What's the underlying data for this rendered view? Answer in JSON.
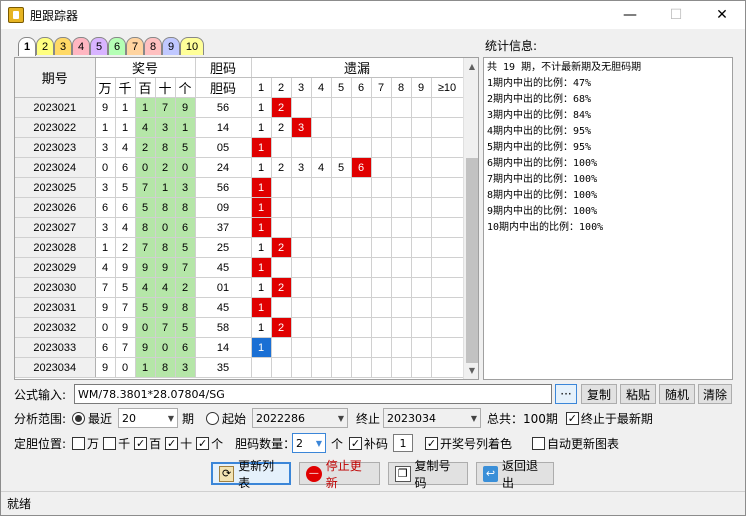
{
  "window": {
    "title": "胆跟踪器",
    "min": "—",
    "max": "☐",
    "close": "✕"
  },
  "tabs": [
    "1",
    "2",
    "3",
    "4",
    "5",
    "6",
    "7",
    "8",
    "9",
    "10"
  ],
  "tab_colors": [
    "#e8e8e8",
    "#ffff80",
    "#ffd966",
    "#ffb6c1",
    "#d8b4ff",
    "#b4ffb4",
    "#ffd4a0",
    "#ffc0c0",
    "#c0c8ff",
    "#ffff99"
  ],
  "grid": {
    "h_period": "期号",
    "h_lottery": "奖号",
    "h_danma": "胆码",
    "h_miss": "遗漏",
    "sub_lottery": [
      "万",
      "千",
      "百",
      "十",
      "个"
    ],
    "sub_danma": "胆码",
    "sub_miss": [
      "1",
      "2",
      "3",
      "4",
      "5",
      "6",
      "7",
      "8",
      "9",
      "≥10"
    ],
    "rows": [
      {
        "period": "2023021",
        "nums": [
          "9",
          "1",
          "1",
          "7",
          "9"
        ],
        "danma": "56",
        "miss": [
          "1",
          "2",
          "",
          "",
          "",
          "",
          "",
          "",
          "",
          ""
        ],
        "marks": [
          "",
          "red",
          "",
          "",
          "",
          "",
          "",
          "",
          "",
          ""
        ]
      },
      {
        "period": "2023022",
        "nums": [
          "1",
          "1",
          "4",
          "3",
          "1"
        ],
        "danma": "14",
        "miss": [
          "1",
          "2",
          "3",
          "",
          "",
          "",
          "",
          "",
          "",
          ""
        ],
        "marks": [
          "",
          "",
          "red",
          "",
          "",
          "",
          "",
          "",
          "",
          ""
        ]
      },
      {
        "period": "2023023",
        "nums": [
          "3",
          "4",
          "2",
          "8",
          "5"
        ],
        "danma": "05",
        "miss": [
          "1",
          "",
          "",
          "",
          "",
          "",
          "",
          "",
          "",
          ""
        ],
        "marks": [
          "red",
          "",
          "",
          "",
          "",
          "",
          "",
          "",
          "",
          ""
        ]
      },
      {
        "period": "2023024",
        "nums": [
          "0",
          "6",
          "0",
          "2",
          "0"
        ],
        "danma": "24",
        "miss": [
          "1",
          "2",
          "3",
          "4",
          "5",
          "6",
          "",
          "",
          "",
          ""
        ],
        "marks": [
          "",
          "",
          "",
          "",
          "",
          "red",
          "",
          "",
          "",
          ""
        ]
      },
      {
        "period": "2023025",
        "nums": [
          "3",
          "5",
          "7",
          "1",
          "3"
        ],
        "danma": "56",
        "miss": [
          "1",
          "",
          "",
          "",
          "",
          "",
          "",
          "",
          "",
          ""
        ],
        "marks": [
          "red",
          "",
          "",
          "",
          "",
          "",
          "",
          "",
          "",
          ""
        ]
      },
      {
        "period": "2023026",
        "nums": [
          "6",
          "6",
          "5",
          "8",
          "8"
        ],
        "danma": "09",
        "miss": [
          "1",
          "",
          "",
          "",
          "",
          "",
          "",
          "",
          "",
          ""
        ],
        "marks": [
          "red",
          "",
          "",
          "",
          "",
          "",
          "",
          "",
          "",
          ""
        ]
      },
      {
        "period": "2023027",
        "nums": [
          "3",
          "4",
          "8",
          "0",
          "6"
        ],
        "danma": "37",
        "miss": [
          "1",
          "",
          "",
          "",
          "",
          "",
          "",
          "",
          "",
          ""
        ],
        "marks": [
          "red",
          "",
          "",
          "",
          "",
          "",
          "",
          "",
          "",
          ""
        ]
      },
      {
        "period": "2023028",
        "nums": [
          "1",
          "2",
          "7",
          "8",
          "5"
        ],
        "danma": "25",
        "miss": [
          "1",
          "2",
          "",
          "",
          "",
          "",
          "",
          "",
          "",
          ""
        ],
        "marks": [
          "",
          "red",
          "",
          "",
          "",
          "",
          "",
          "",
          "",
          ""
        ]
      },
      {
        "period": "2023029",
        "nums": [
          "4",
          "9",
          "9",
          "9",
          "7"
        ],
        "danma": "45",
        "miss": [
          "1",
          "",
          "",
          "",
          "",
          "",
          "",
          "",
          "",
          ""
        ],
        "marks": [
          "red",
          "",
          "",
          "",
          "",
          "",
          "",
          "",
          "",
          ""
        ]
      },
      {
        "period": "2023030",
        "nums": [
          "7",
          "5",
          "4",
          "4",
          "2"
        ],
        "danma": "01",
        "miss": [
          "1",
          "2",
          "",
          "",
          "",
          "",
          "",
          "",
          "",
          ""
        ],
        "marks": [
          "",
          "red",
          "",
          "",
          "",
          "",
          "",
          "",
          "",
          ""
        ]
      },
      {
        "period": "2023031",
        "nums": [
          "9",
          "7",
          "5",
          "9",
          "8"
        ],
        "danma": "45",
        "miss": [
          "1",
          "",
          "",
          "",
          "",
          "",
          "",
          "",
          "",
          ""
        ],
        "marks": [
          "red",
          "",
          "",
          "",
          "",
          "",
          "",
          "",
          "",
          ""
        ]
      },
      {
        "period": "2023032",
        "nums": [
          "0",
          "9",
          "0",
          "7",
          "5"
        ],
        "danma": "58",
        "miss": [
          "1",
          "2",
          "",
          "",
          "",
          "",
          "",
          "",
          "",
          ""
        ],
        "marks": [
          "",
          "red",
          "",
          "",
          "",
          "",
          "",
          "",
          "",
          ""
        ]
      },
      {
        "period": "2023033",
        "nums": [
          "6",
          "7",
          "9",
          "0",
          "6"
        ],
        "danma": "14",
        "miss": [
          "1",
          "",
          "",
          "",
          "",
          "",
          "",
          "",
          "",
          ""
        ],
        "marks": [
          "blue",
          "",
          "",
          "",
          "",
          "",
          "",
          "",
          "",
          ""
        ]
      },
      {
        "period": "2023034",
        "nums": [
          "9",
          "0",
          "1",
          "8",
          "3"
        ],
        "danma": "35",
        "miss": [
          "",
          "",
          "",
          "",
          "",
          "",
          "",
          "",
          "",
          ""
        ],
        "marks": [
          "",
          "",
          "",
          "",
          "",
          "",
          "",
          "",
          "",
          ""
        ]
      }
    ]
  },
  "stats": {
    "label": "统计信息:",
    "lines": [
      "共 19 期，不计最新期及无胆码期",
      "1期内中出的比例：47%",
      "2期内中出的比例：68%",
      "3期内中出的比例：84%",
      "4期内中出的比例：95%",
      "5期内中出的比例：95%",
      "6期内中出的比例：100%",
      "7期内中出的比例：100%",
      "8期内中出的比例：100%",
      "9期内中出的比例：100%",
      "10期内中出的比例：100%"
    ]
  },
  "formula": {
    "label": "公式输入:",
    "value": "WM/78.3801*28.07804/SG",
    "more": "···",
    "copy": "复制",
    "paste": "粘贴",
    "random": "随机",
    "clear": "清除"
  },
  "range": {
    "label": "分析范围:",
    "recent_label": "最近",
    "recent_value": "20",
    "period_unit": "期",
    "start_label": "起始",
    "start_value": "2022286",
    "end_label": "终止",
    "end_value": "2023034",
    "total": "总共：100期",
    "end_latest_label": "终止于最新期"
  },
  "position": {
    "label": "定胆位置:",
    "w": "万",
    "q": "千",
    "b": "百",
    "s": "十",
    "g": "个",
    "count_label": "胆码数量：",
    "count_value": "2",
    "unit": "个",
    "fill_label": "补码",
    "fill_value": "1",
    "color_label": "开奖号列着色",
    "auto_label": "自动更新图表"
  },
  "buttons": {
    "refresh": "更新列表",
    "stop": "停止更新",
    "copy_nums": "复制号码",
    "exit": "返回退出"
  },
  "status": "就绪"
}
